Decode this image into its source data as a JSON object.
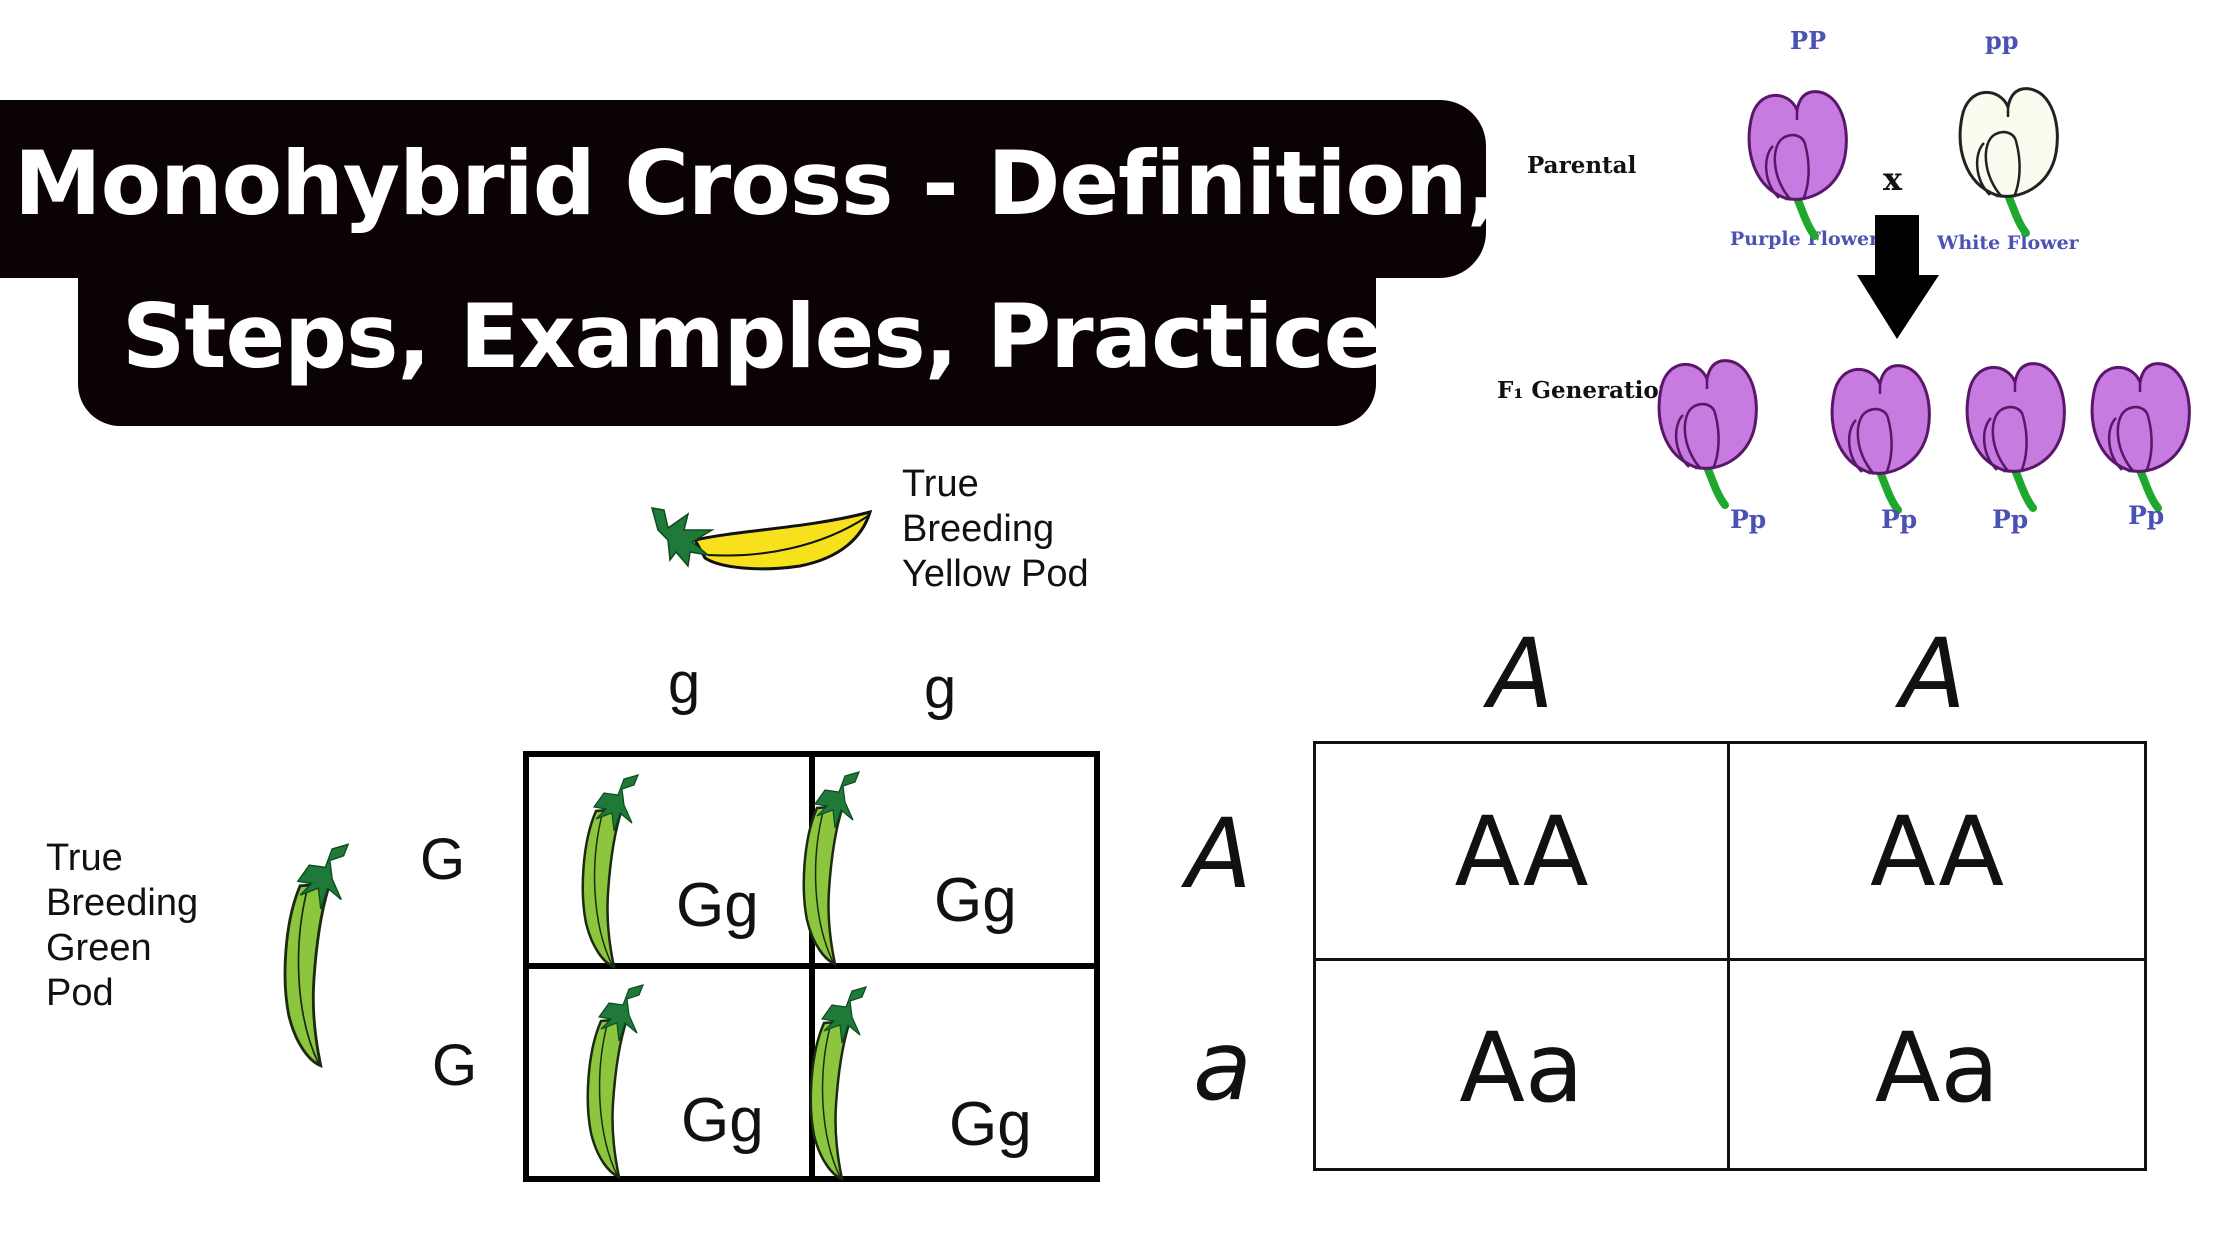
{
  "title": {
    "line1": "Monohybrid Cross - Definition,",
    "line2": "Steps, Examples, Practice"
  },
  "flower_cross": {
    "parental_label": "Parental",
    "f1_label": "F₁ Generation",
    "cross_symbol": "x",
    "parents": [
      {
        "genotype": "PP",
        "name": "Purple Flower",
        "color": "#c77ae0"
      },
      {
        "genotype": "pp",
        "name": "White Flower",
        "color": "#fbfbef"
      }
    ],
    "offspring": [
      {
        "genotype": "Pp",
        "color": "#c77ae0"
      },
      {
        "genotype": "Pp",
        "color": "#c77ae0"
      },
      {
        "genotype": "Pp",
        "color": "#c77ae0"
      },
      {
        "genotype": "Pp",
        "color": "#c77ae0"
      }
    ],
    "label_color": "#4a52b4"
  },
  "pod_cross": {
    "yellow_parent_label": [
      "True",
      "Breeding",
      "Yellow Pod"
    ],
    "green_parent_label": [
      "True",
      "Breeding",
      "Green",
      "Pod"
    ],
    "column_alleles": [
      "g",
      "g"
    ],
    "row_alleles": [
      "G",
      "G"
    ],
    "cells": [
      [
        "Gg",
        "Gg"
      ],
      [
        "Gg",
        "Gg"
      ]
    ],
    "pod_color_green": "#8cc63f",
    "pod_color_yellow": "#f6e11c"
  },
  "allele_square": {
    "column_alleles": [
      "A",
      "A"
    ],
    "row_alleles": [
      "A",
      "a"
    ],
    "cells": [
      [
        "AA",
        "AA"
      ],
      [
        "Aa",
        "Aa"
      ]
    ]
  }
}
